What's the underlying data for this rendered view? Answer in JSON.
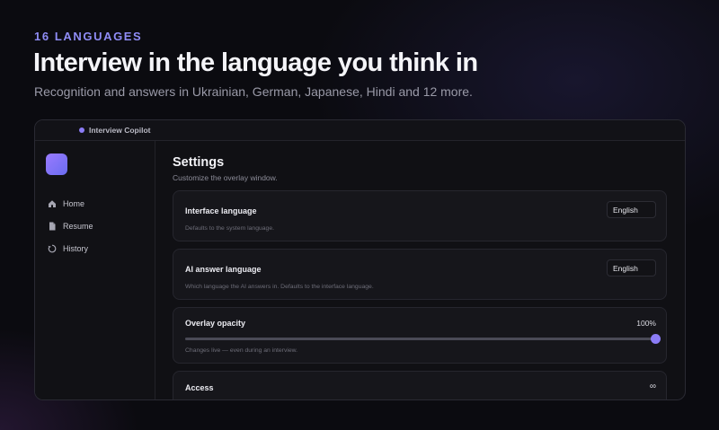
{
  "hero": {
    "eyebrow": "16 LANGUAGES",
    "headline": "Interview in the language you think in",
    "subline": "Recognition and answers in Ukrainian, German, Japanese, Hindi and 12 more."
  },
  "window": {
    "title": "Interview Copilot",
    "accent_color": "#8b7cf6"
  },
  "sidebar": {
    "items": [
      {
        "label": "Home",
        "icon": "home-icon"
      },
      {
        "label": "Resume",
        "icon": "document-icon"
      },
      {
        "label": "History",
        "icon": "history-icon"
      }
    ]
  },
  "settings": {
    "title": "Settings",
    "description": "Customize the overlay window.",
    "interface_language": {
      "label": "Interface language",
      "value": "English",
      "hint": "Defaults to the system language."
    },
    "ai_answer_language": {
      "label": "AI answer language",
      "value": "English",
      "hint": "Which language the AI answers in. Defaults to the interface language."
    },
    "overlay_opacity": {
      "label": "Overlay opacity",
      "value_text": "100%",
      "level": 1.0,
      "hint": "Changes live — even during an interview."
    },
    "access": {
      "label": "Access",
      "value_text": "∞"
    }
  }
}
